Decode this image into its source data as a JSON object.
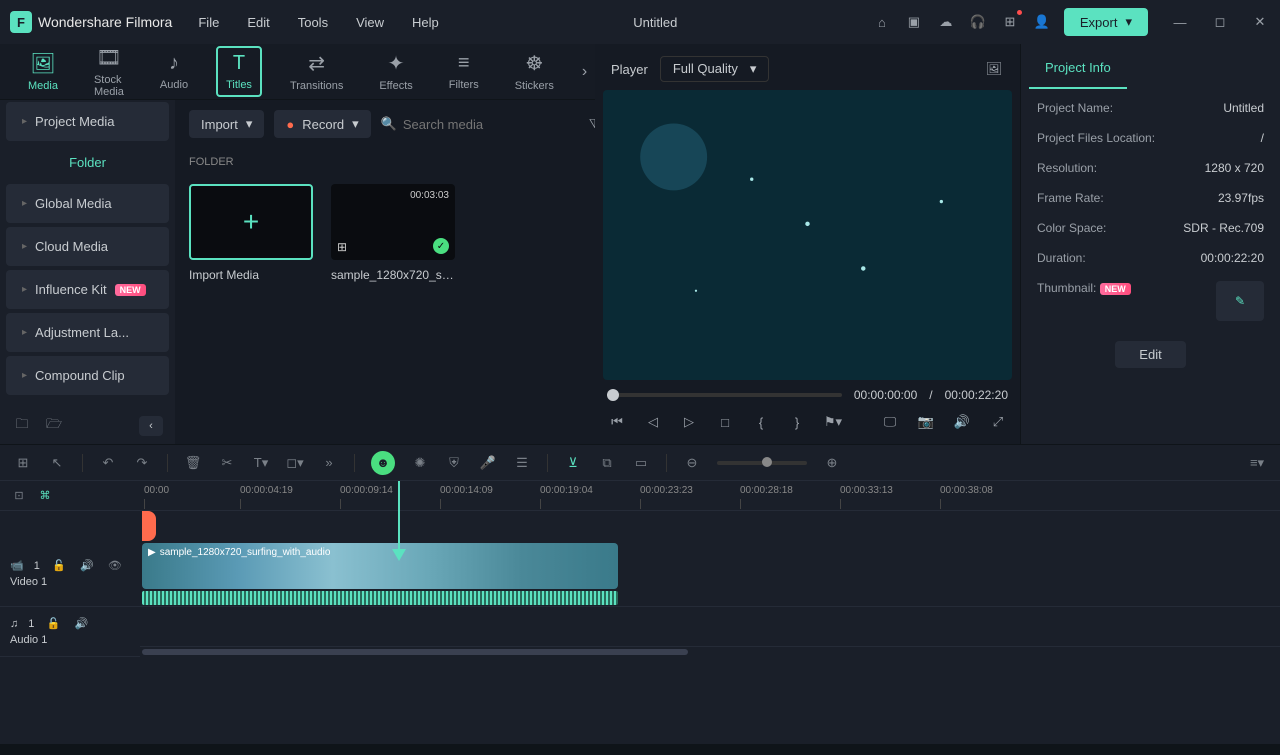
{
  "app": {
    "name": "Wondershare Filmora",
    "document": "Untitled"
  },
  "menu": [
    "File",
    "Edit",
    "Tools",
    "View",
    "Help"
  ],
  "export_label": "Export",
  "tabs": [
    {
      "label": "Media",
      "icon": "🖼",
      "active": true
    },
    {
      "label": "Stock Media",
      "icon": "🎞"
    },
    {
      "label": "Audio",
      "icon": "♪"
    },
    {
      "label": "Titles",
      "icon": "T",
      "selected": true
    },
    {
      "label": "Transitions",
      "icon": "⇄"
    },
    {
      "label": "Effects",
      "icon": "✦"
    },
    {
      "label": "Filters",
      "icon": "≡"
    },
    {
      "label": "Stickers",
      "icon": "☸"
    }
  ],
  "sidebar": {
    "project_media": "Project Media",
    "folder": "Folder",
    "items": [
      "Global Media",
      "Cloud Media",
      "Influence Kit",
      "Adjustment La...",
      "Compound Clip"
    ],
    "new_badge": "NEW"
  },
  "media_toolbar": {
    "import": "Import",
    "record": "Record",
    "search_placeholder": "Search media"
  },
  "folder_label": "FOLDER",
  "media": {
    "import_label": "Import Media",
    "clip_name": "sample_1280x720_surf...",
    "clip_duration": "00:03:03"
  },
  "preview": {
    "player_label": "Player",
    "quality": "Full Quality",
    "current": "00:00:00:00",
    "sep": "/",
    "total": "00:00:22:20"
  },
  "right": {
    "tab": "Project Info",
    "rows": [
      [
        "Project Name:",
        "Untitled"
      ],
      [
        "Project Files Location:",
        "/"
      ],
      [
        "Resolution:",
        "1280 x 720"
      ],
      [
        "Frame Rate:",
        "23.97fps"
      ],
      [
        "Color Space:",
        "SDR - Rec.709"
      ],
      [
        "Duration:",
        "00:00:22:20"
      ]
    ],
    "thumbnail_label": "Thumbnail:",
    "new_badge": "NEW",
    "edit": "Edit"
  },
  "timeline": {
    "ruler": [
      "00:00",
      "00:00:04:19",
      "00:00:09:14",
      "00:00:14:09",
      "00:00:19:04",
      "00:00:23:23",
      "00:00:28:18",
      "00:00:33:13",
      "00:00:38:08"
    ],
    "video_track": "Video 1",
    "audio_track": "Audio 1",
    "video_idx": "1",
    "audio_idx": "1",
    "clip_label": "sample_1280x720_surfing_with_audio"
  }
}
